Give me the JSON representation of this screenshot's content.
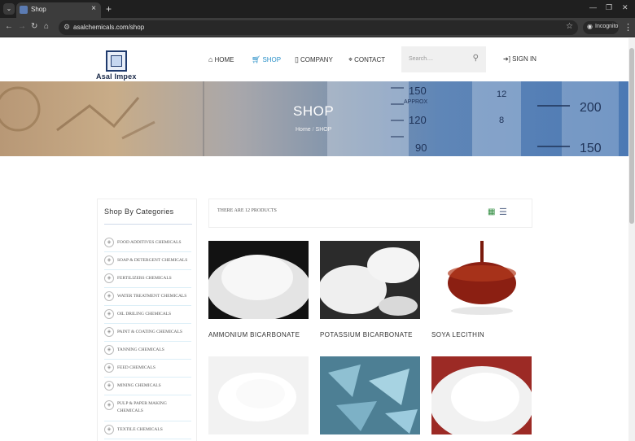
{
  "browser": {
    "tab_title": "Shop",
    "url": "asalchemicals.com/shop",
    "incognito_label": "Incognito"
  },
  "header": {
    "logo_text": "Asal Impex",
    "nav": [
      {
        "label": "HOME"
      },
      {
        "label": "SHOP"
      },
      {
        "label": "COMPANY"
      },
      {
        "label": "CONTACT"
      }
    ],
    "search_placeholder": "Search....",
    "signin_label": "SIGN IN"
  },
  "banner": {
    "title": "SHOP",
    "breadcrumb": [
      "Home",
      "SHOP"
    ],
    "scale_numbers": [
      "150",
      "APPROX",
      "120",
      "90",
      "12",
      "8",
      "200",
      "150"
    ]
  },
  "sidebar": {
    "title": "Shop By Categories",
    "categories": [
      "FOOD ADDITIVES CHEMICALS",
      "SOAP & DETERGENT CHEMICALS",
      "FERTILIZERS CHEMICALS",
      "WATER TREATMENT CHEMICALS",
      "OIL DRILING CHEMICALS",
      "PAINT & COATING CHEMICALS",
      "TANNING CHEMICALS",
      "FEED CHEMICALS",
      "MINING CHEMICALS",
      "PULP & PAPER MAKING CHEMICALS",
      "TEXTILE CHEMICALS"
    ]
  },
  "products_bar": {
    "count_text": "THERE ARE 12 PRODUCTS"
  },
  "products": [
    {
      "name": "AMMONIUM BICARBONATE"
    },
    {
      "name": "POTASSIUM BICARBONATE"
    },
    {
      "name": "SOYA LECITHIN"
    },
    {
      "name": ""
    },
    {
      "name": ""
    },
    {
      "name": ""
    }
  ],
  "colors": {
    "accent": "#2a90c8",
    "brand_navy": "#1f3a6d",
    "grid_view_green": "#2e8b3e"
  }
}
